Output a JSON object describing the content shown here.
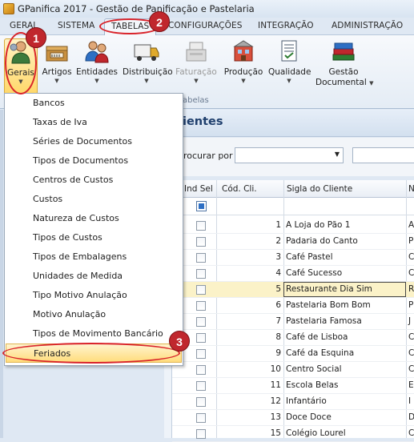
{
  "window": {
    "title": "GPanifica 2017 - Gestão de Panificação e Pastelaria"
  },
  "menu_tabs": [
    "GERAL",
    "SISTEMA",
    "TABELAS",
    "CONFIGURAÇÕES",
    "INTEGRAÇÃO",
    "ADMINISTRAÇÃO"
  ],
  "ribbon": {
    "buttons": [
      {
        "label": "Gerais",
        "icon": "person-settings-icon",
        "state": "selected"
      },
      {
        "label": "Artigos",
        "icon": "boxes-icon"
      },
      {
        "label": "Entidades",
        "icon": "people-icon"
      },
      {
        "label": "Distribuição",
        "icon": "truck-icon"
      },
      {
        "label": "Faturação",
        "icon": "cash-register-icon",
        "state": "disabled"
      },
      {
        "label": "Produção",
        "icon": "factory-icon"
      },
      {
        "label": "Qualidade",
        "icon": "document-check-icon"
      },
      {
        "label": "Gestão",
        "label2": "Documental",
        "icon": "books-icon"
      }
    ],
    "group_label": "abelas"
  },
  "dropdown": {
    "items": [
      "Bancos",
      "Taxas de Iva",
      "Séries de Documentos",
      "Tipos de Documentos",
      "Centros de Custos",
      "Custos",
      "Natureza de Custos",
      "Tipos de Custos",
      "Tipos de Embalagens",
      "Unidades de Medida",
      "Tipo Motivo Anulação",
      "Motivo Anulação",
      "Tipos de Movimento Bancário",
      "Feriados"
    ],
    "selected": "Feriados"
  },
  "panel": {
    "title": "ientes",
    "search_label": "rocurar por :"
  },
  "grid": {
    "columns": [
      "Ind Sel",
      "Cód. Cli.",
      "Sigla do Cliente",
      "N"
    ],
    "rows": [
      {
        "code": "1",
        "sigla": "A Loja do Pão 1",
        "extra": "A"
      },
      {
        "code": "2",
        "sigla": "Padaria do Canto",
        "extra": "P"
      },
      {
        "code": "3",
        "sigla": "Café Pastel",
        "extra": "C"
      },
      {
        "code": "4",
        "sigla": "Café Sucesso",
        "extra": "C"
      },
      {
        "code": "5",
        "sigla": "Restaurante Dia Sim",
        "extra": "R"
      },
      {
        "code": "6",
        "sigla": "Pastelaria Bom Bom",
        "extra": "P"
      },
      {
        "code": "7",
        "sigla": "Pastelaria Famosa",
        "extra": "J"
      },
      {
        "code": "8",
        "sigla": "Café de Lisboa",
        "extra": "C"
      },
      {
        "code": "9",
        "sigla": "Café da Esquina",
        "extra": "C"
      },
      {
        "code": "10",
        "sigla": "Centro Social",
        "extra": "C"
      },
      {
        "code": "11",
        "sigla": "Escola Belas",
        "extra": "E"
      },
      {
        "code": "12",
        "sigla": "Infantário",
        "extra": "I"
      },
      {
        "code": "13",
        "sigla": "Doce Doce",
        "extra": "D"
      },
      {
        "code": "15",
        "sigla": "Colégio Lourel",
        "extra": "C"
      }
    ],
    "highlighted_row": "5"
  },
  "annotations": [
    "1",
    "2",
    "3"
  ],
  "colors": {
    "accent": "#1f3f6d",
    "highlight": "#ffdc7c",
    "annotation": "#c0272d"
  }
}
